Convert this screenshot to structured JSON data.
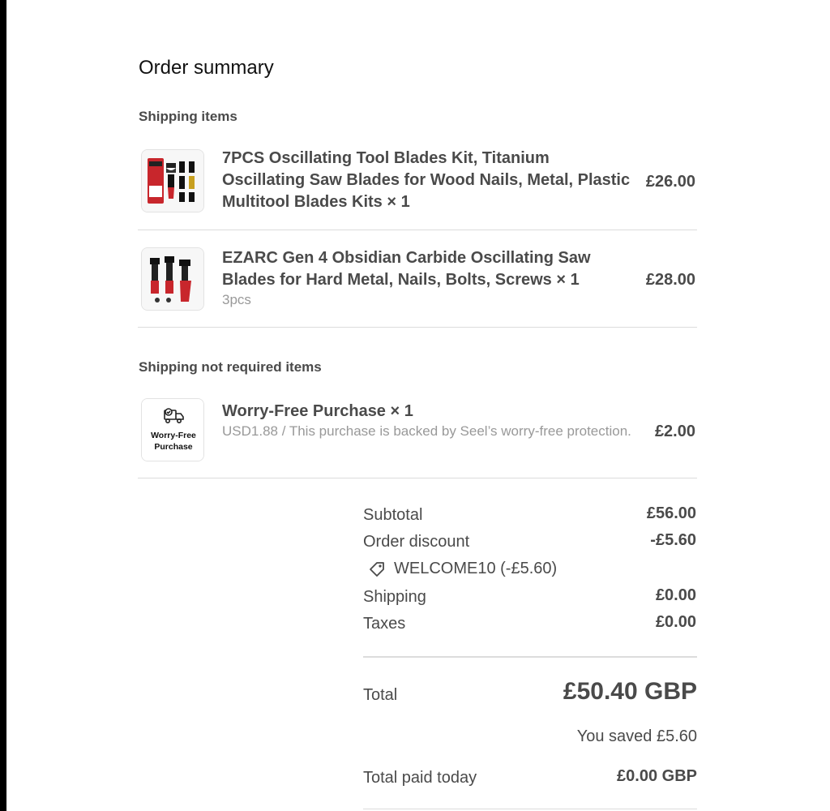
{
  "page": {
    "title": "Order summary"
  },
  "sections": {
    "shipping": "Shipping items",
    "no_shipping": "Shipping not required items"
  },
  "items": [
    {
      "title": "7PCS Oscillating Tool Blades Kit, Titanium Oscillating Saw Blades for Wood Nails, Metal, Plastic Multitool Blades Kits × 1",
      "subtitle": "",
      "price": "£26.00",
      "icon": "blade-kit-image"
    },
    {
      "title": "EZARC Gen 4 Obsidian Carbide Oscillating Saw Blades for Hard Metal, Nails, Bolts, Screws × 1",
      "subtitle": "3pcs",
      "price": "£28.00",
      "icon": "carbide-blades-image"
    },
    {
      "title": "Worry-Free Purchase × 1",
      "subtitle": "USD1.88 / This purchase is backed by Seel’s worry-free protection.",
      "price": "£2.00",
      "icon": "delivery-truck-icon",
      "badge_line1": "Worry-Free",
      "badge_line2": "Purchase"
    }
  ],
  "summary": {
    "subtotal_label": "Subtotal",
    "subtotal_value": "£56.00",
    "discount_label": "Order discount",
    "discount_value": "-£5.60",
    "discount_code": "WELCOME10 (-£5.60)",
    "shipping_label": "Shipping",
    "shipping_value": "£0.00",
    "taxes_label": "Taxes",
    "taxes_value": "£0.00",
    "total_label": "Total",
    "total_value": "£50.40 GBP",
    "saved": "You saved £5.60",
    "paid_label": "Total paid today",
    "paid_value": "£0.00 GBP"
  },
  "colors": {
    "text": "#4a4a4a",
    "muted": "#999999",
    "divider": "#dcdcdc",
    "product_red": "#c8262c"
  }
}
